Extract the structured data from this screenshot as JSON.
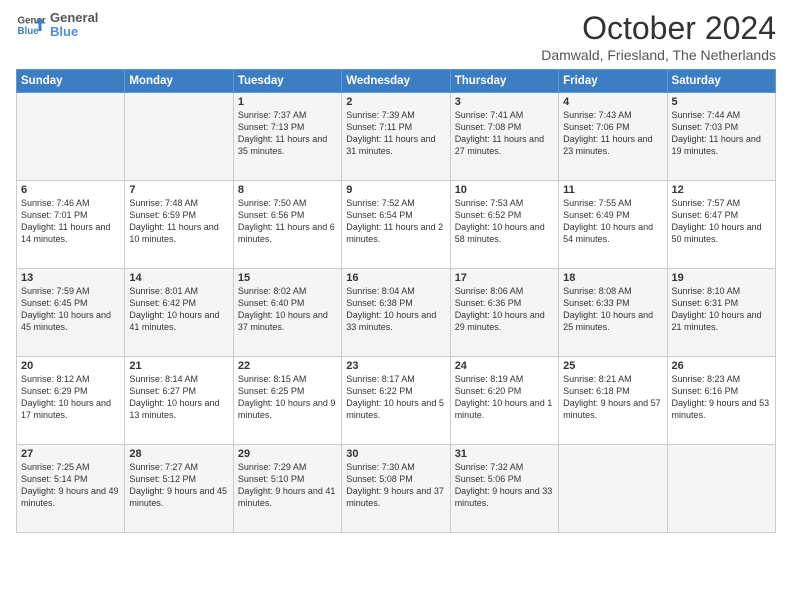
{
  "header": {
    "logo_general": "General",
    "logo_blue": "Blue",
    "title": "October 2024",
    "subtitle": "Damwald, Friesland, The Netherlands"
  },
  "weekdays": [
    "Sunday",
    "Monday",
    "Tuesday",
    "Wednesday",
    "Thursday",
    "Friday",
    "Saturday"
  ],
  "weeks": [
    [
      {
        "day": "",
        "info": ""
      },
      {
        "day": "",
        "info": ""
      },
      {
        "day": "1",
        "info": "Sunrise: 7:37 AM\nSunset: 7:13 PM\nDaylight: 11 hours and 35 minutes."
      },
      {
        "day": "2",
        "info": "Sunrise: 7:39 AM\nSunset: 7:11 PM\nDaylight: 11 hours and 31 minutes."
      },
      {
        "day": "3",
        "info": "Sunrise: 7:41 AM\nSunset: 7:08 PM\nDaylight: 11 hours and 27 minutes."
      },
      {
        "day": "4",
        "info": "Sunrise: 7:43 AM\nSunset: 7:06 PM\nDaylight: 11 hours and 23 minutes."
      },
      {
        "day": "5",
        "info": "Sunrise: 7:44 AM\nSunset: 7:03 PM\nDaylight: 11 hours and 19 minutes."
      }
    ],
    [
      {
        "day": "6",
        "info": "Sunrise: 7:46 AM\nSunset: 7:01 PM\nDaylight: 11 hours and 14 minutes."
      },
      {
        "day": "7",
        "info": "Sunrise: 7:48 AM\nSunset: 6:59 PM\nDaylight: 11 hours and 10 minutes."
      },
      {
        "day": "8",
        "info": "Sunrise: 7:50 AM\nSunset: 6:56 PM\nDaylight: 11 hours and 6 minutes."
      },
      {
        "day": "9",
        "info": "Sunrise: 7:52 AM\nSunset: 6:54 PM\nDaylight: 11 hours and 2 minutes."
      },
      {
        "day": "10",
        "info": "Sunrise: 7:53 AM\nSunset: 6:52 PM\nDaylight: 10 hours and 58 minutes."
      },
      {
        "day": "11",
        "info": "Sunrise: 7:55 AM\nSunset: 6:49 PM\nDaylight: 10 hours and 54 minutes."
      },
      {
        "day": "12",
        "info": "Sunrise: 7:57 AM\nSunset: 6:47 PM\nDaylight: 10 hours and 50 minutes."
      }
    ],
    [
      {
        "day": "13",
        "info": "Sunrise: 7:59 AM\nSunset: 6:45 PM\nDaylight: 10 hours and 45 minutes."
      },
      {
        "day": "14",
        "info": "Sunrise: 8:01 AM\nSunset: 6:42 PM\nDaylight: 10 hours and 41 minutes."
      },
      {
        "day": "15",
        "info": "Sunrise: 8:02 AM\nSunset: 6:40 PM\nDaylight: 10 hours and 37 minutes."
      },
      {
        "day": "16",
        "info": "Sunrise: 8:04 AM\nSunset: 6:38 PM\nDaylight: 10 hours and 33 minutes."
      },
      {
        "day": "17",
        "info": "Sunrise: 8:06 AM\nSunset: 6:36 PM\nDaylight: 10 hours and 29 minutes."
      },
      {
        "day": "18",
        "info": "Sunrise: 8:08 AM\nSunset: 6:33 PM\nDaylight: 10 hours and 25 minutes."
      },
      {
        "day": "19",
        "info": "Sunrise: 8:10 AM\nSunset: 6:31 PM\nDaylight: 10 hours and 21 minutes."
      }
    ],
    [
      {
        "day": "20",
        "info": "Sunrise: 8:12 AM\nSunset: 6:29 PM\nDaylight: 10 hours and 17 minutes."
      },
      {
        "day": "21",
        "info": "Sunrise: 8:14 AM\nSunset: 6:27 PM\nDaylight: 10 hours and 13 minutes."
      },
      {
        "day": "22",
        "info": "Sunrise: 8:15 AM\nSunset: 6:25 PM\nDaylight: 10 hours and 9 minutes."
      },
      {
        "day": "23",
        "info": "Sunrise: 8:17 AM\nSunset: 6:22 PM\nDaylight: 10 hours and 5 minutes."
      },
      {
        "day": "24",
        "info": "Sunrise: 8:19 AM\nSunset: 6:20 PM\nDaylight: 10 hours and 1 minute."
      },
      {
        "day": "25",
        "info": "Sunrise: 8:21 AM\nSunset: 6:18 PM\nDaylight: 9 hours and 57 minutes."
      },
      {
        "day": "26",
        "info": "Sunrise: 8:23 AM\nSunset: 6:16 PM\nDaylight: 9 hours and 53 minutes."
      }
    ],
    [
      {
        "day": "27",
        "info": "Sunrise: 7:25 AM\nSunset: 5:14 PM\nDaylight: 9 hours and 49 minutes."
      },
      {
        "day": "28",
        "info": "Sunrise: 7:27 AM\nSunset: 5:12 PM\nDaylight: 9 hours and 45 minutes."
      },
      {
        "day": "29",
        "info": "Sunrise: 7:29 AM\nSunset: 5:10 PM\nDaylight: 9 hours and 41 minutes."
      },
      {
        "day": "30",
        "info": "Sunrise: 7:30 AM\nSunset: 5:08 PM\nDaylight: 9 hours and 37 minutes."
      },
      {
        "day": "31",
        "info": "Sunrise: 7:32 AM\nSunset: 5:06 PM\nDaylight: 9 hours and 33 minutes."
      },
      {
        "day": "",
        "info": ""
      },
      {
        "day": "",
        "info": ""
      }
    ]
  ]
}
